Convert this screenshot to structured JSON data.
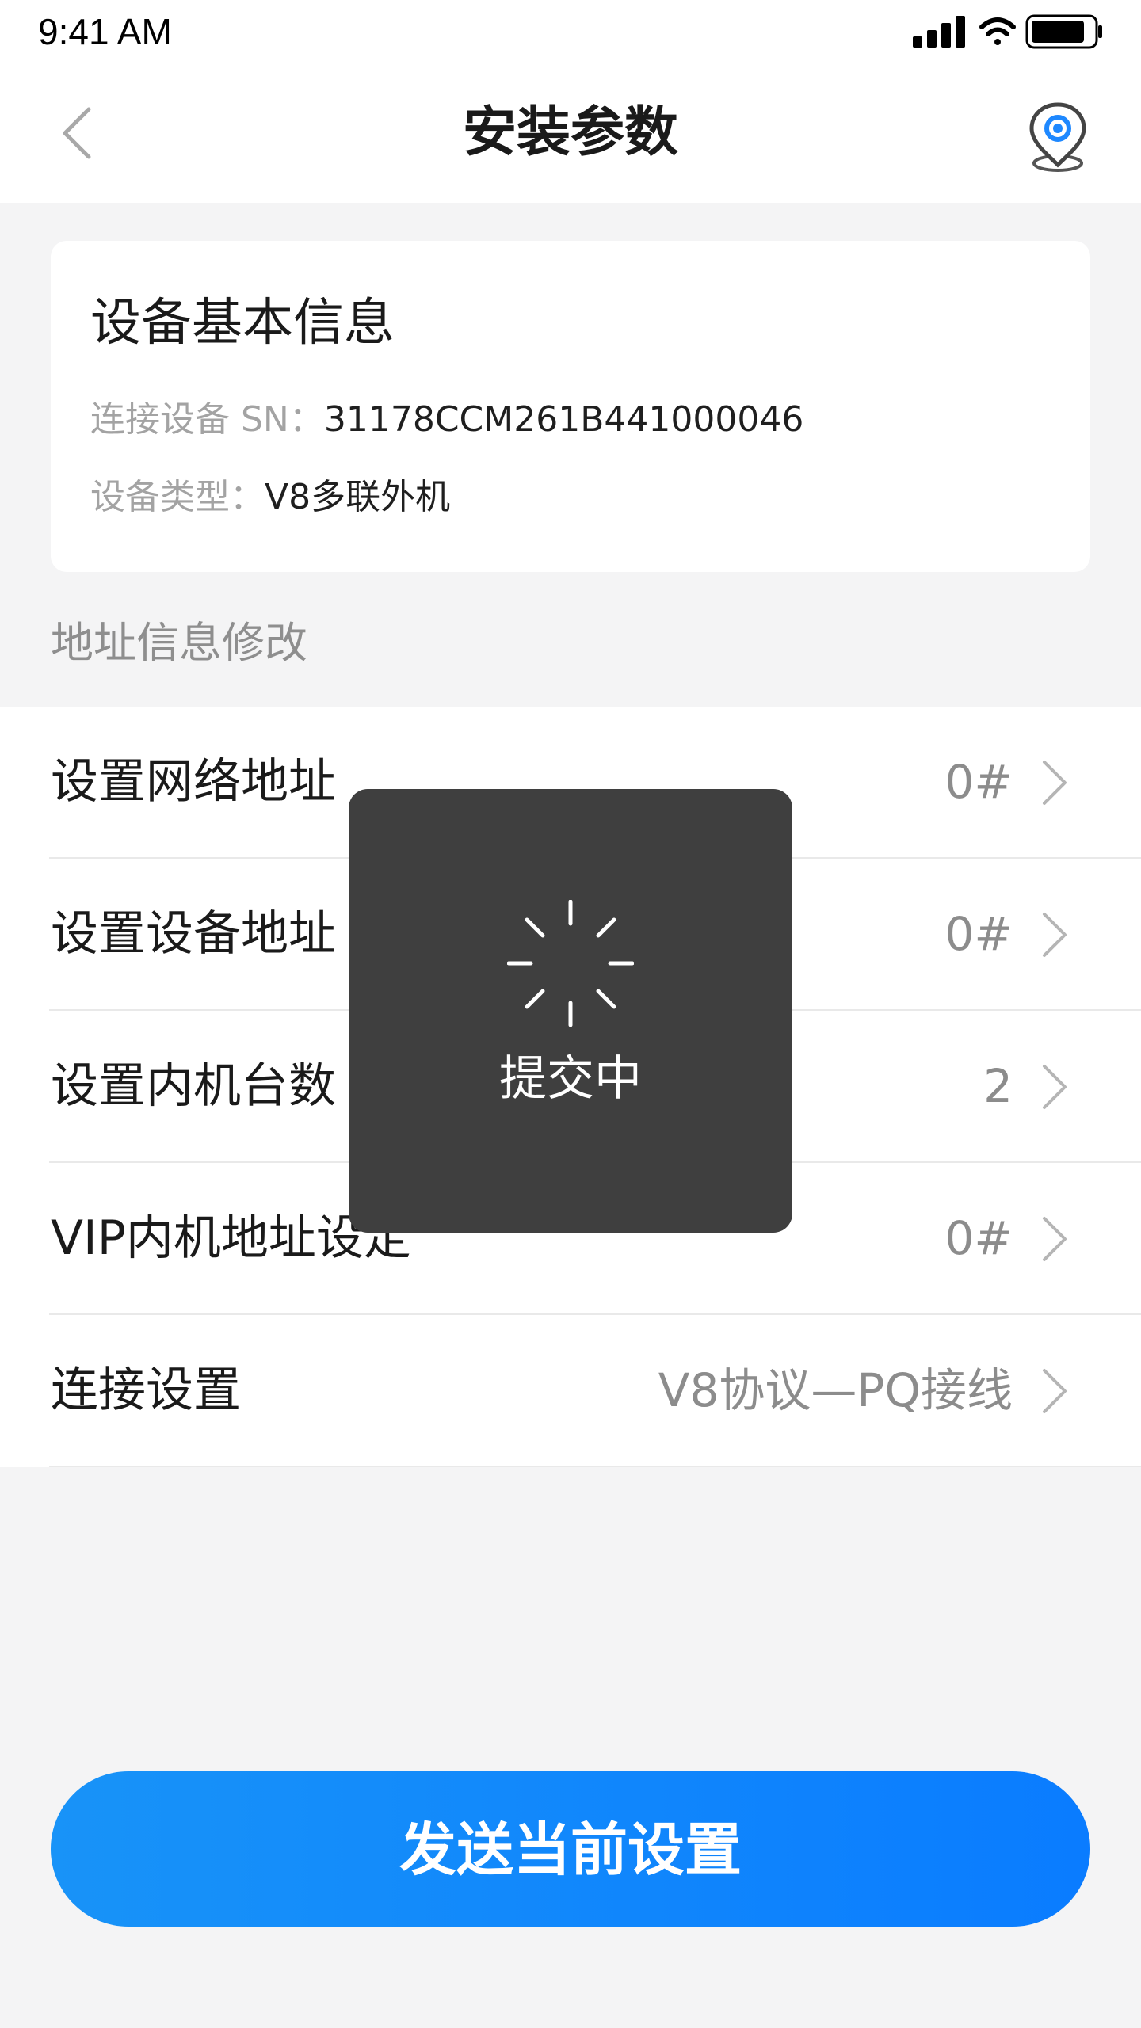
{
  "status_bar": {
    "time": "9:41 AM"
  },
  "nav": {
    "title": "安装参数",
    "back_icon": "chevron-left-icon",
    "location_icon": "location-pin-icon"
  },
  "device_info": {
    "title": "设备基本信息",
    "sn_label": "连接设备 SN：",
    "sn_value": "31178CCM261B441000046",
    "type_label": "设备类型：",
    "type_value": "V8多联外机"
  },
  "section_header": "地址信息修改",
  "settings": [
    {
      "label": "设置网络地址",
      "value": "0#"
    },
    {
      "label": "设置设备地址",
      "value": "0#"
    },
    {
      "label": "设置内机台数",
      "value": "2"
    },
    {
      "label": "VIP内机地址设定",
      "value": "0#"
    },
    {
      "label": "连接设置",
      "value": "V8协议—PQ接线"
    }
  ],
  "submit_button": "发送当前设置",
  "loading": {
    "text": "提交中",
    "icon": "spinner-icon"
  },
  "colors": {
    "accent": "#0a7cff",
    "toast_bg": "#3f3f3f",
    "background": "#f4f4f5"
  }
}
